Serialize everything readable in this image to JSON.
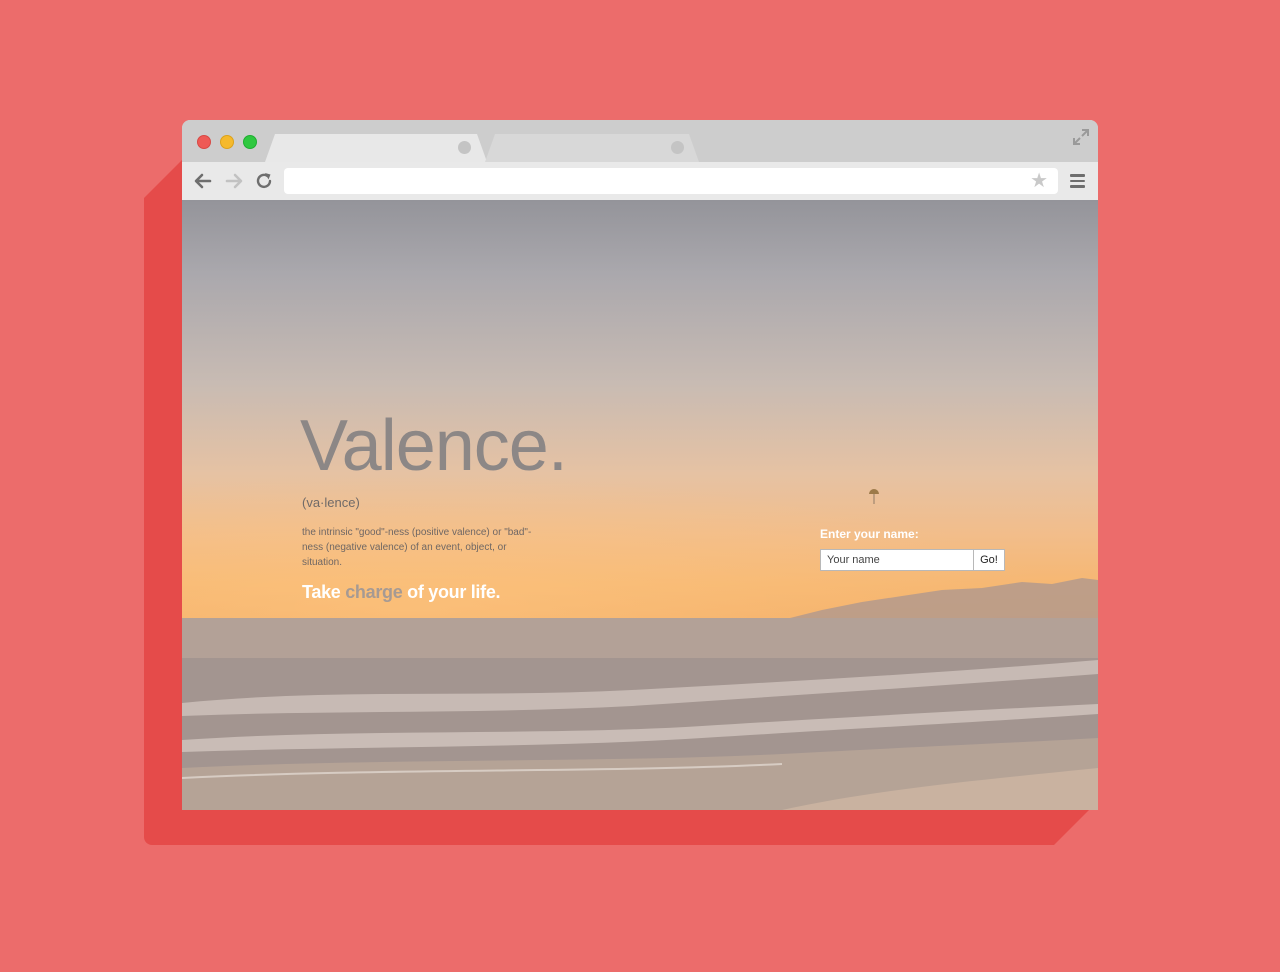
{
  "browser": {
    "address_value": "",
    "icons": [
      "back-arrow-icon",
      "forward-arrow-icon",
      "reload-icon",
      "star-icon",
      "menu-icon",
      "fullscreen-icon"
    ],
    "traffic_lights": {
      "close": "#ee5a56",
      "minimize": "#f5b92c",
      "zoom": "#2fc840"
    }
  },
  "hero": {
    "title": "Valence.",
    "pronunciation": "(va·lence)",
    "definition": "the intrinsic \"good\"-ness (positive valence) or \"bad\"-ness (negative valence) of an event, object, or situation.",
    "tagline_before": "Take ",
    "tagline_accent": "charge",
    "tagline_after": " of your life."
  },
  "form": {
    "label": "Enter your name:",
    "placeholder": "Your name",
    "button_label": "Go!"
  },
  "colors": {
    "page_background": "#ec6c6b",
    "shadow": "#e54b4a",
    "tagline_accent": "#a69a93"
  }
}
